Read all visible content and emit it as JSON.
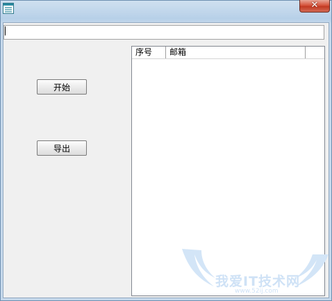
{
  "titlebar": {
    "icon": "app-window-icon",
    "close_glyph": "✕"
  },
  "input": {
    "value": "",
    "placeholder": ""
  },
  "buttons": {
    "start_label": "开始",
    "export_label": "导出"
  },
  "list": {
    "columns": [
      "序号",
      "邮箱",
      ""
    ]
  },
  "watermark": {
    "text": "我爱IT技术网",
    "sub": "www.52ij.com"
  },
  "colors": {
    "titlebar": "#b7d0e8",
    "client_bg": "#f0f0f0",
    "close_button": "#c23a22",
    "watermark": "#cfe2f6"
  }
}
